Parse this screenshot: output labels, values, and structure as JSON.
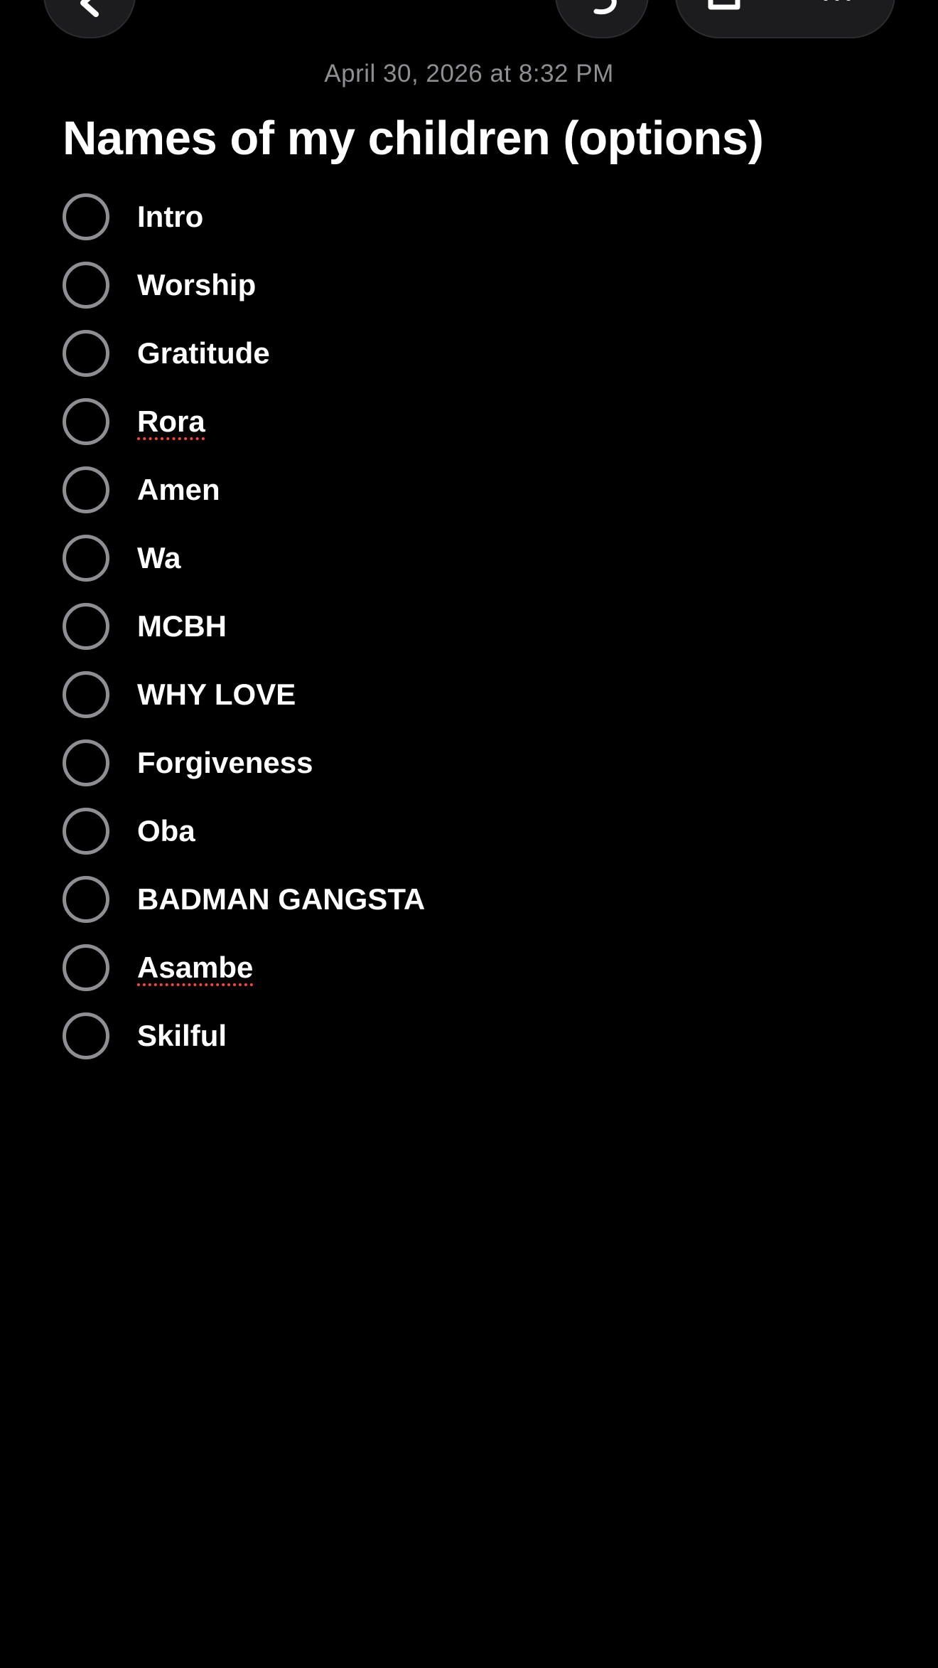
{
  "toolbar": {
    "back_icon": "chevron-left-icon",
    "redo_icon": "redo-icon",
    "share_icon": "share-icon",
    "more_icon": "ellipsis-icon"
  },
  "note": {
    "timestamp": "April 30, 2026 at 8:32 PM",
    "title": "Names of my children (options)",
    "items": [
      {
        "label": "Intro",
        "checked": false,
        "misspelled": false
      },
      {
        "label": "Worship",
        "checked": false,
        "misspelled": false
      },
      {
        "label": "Gratitude",
        "checked": false,
        "misspelled": false
      },
      {
        "label": "Rora",
        "checked": false,
        "misspelled": true
      },
      {
        "label": "Amen",
        "checked": false,
        "misspelled": false
      },
      {
        "label": "Wa",
        "checked": false,
        "misspelled": false
      },
      {
        "label": "MCBH",
        "checked": false,
        "misspelled": false
      },
      {
        "label": "WHY LOVE",
        "checked": false,
        "misspelled": false
      },
      {
        "label": "Forgiveness",
        "checked": false,
        "misspelled": false
      },
      {
        "label": "Oba",
        "checked": false,
        "misspelled": false
      },
      {
        "label": "BADMAN GANGSTA",
        "checked": false,
        "misspelled": false
      },
      {
        "label": "Asambe",
        "checked": false,
        "misspelled": true
      },
      {
        "label": "Skilful",
        "checked": false,
        "misspelled": false
      }
    ]
  },
  "colors": {
    "background": "#000000",
    "text": "#ffffff",
    "secondary_text": "#8e8e93",
    "checkbox_border": "#8e8e93",
    "toolbar_button": "#1c1c1e",
    "spellcheck_underline": "#ff453a"
  }
}
